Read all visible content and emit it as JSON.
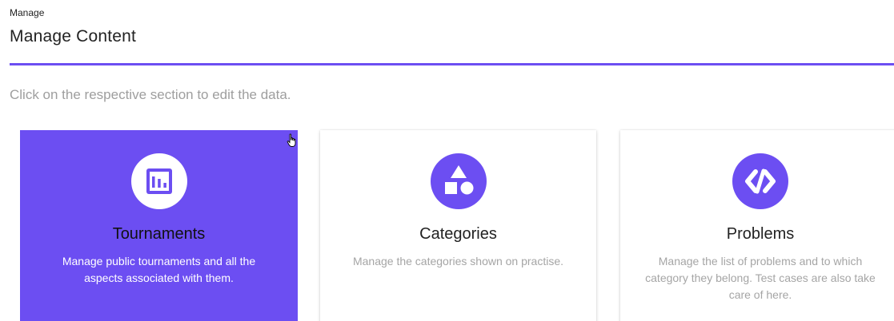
{
  "header": {
    "breadcrumb": "Manage",
    "title": "Manage Content"
  },
  "hint": "Click on the respective section to edit the data.",
  "cards": [
    {
      "title": "Tournaments",
      "description": "Manage public tournaments and all the aspects associated with them.",
      "icon": "bar-chart-icon",
      "active": true
    },
    {
      "title": "Categories",
      "description": "Manage the categories shown on practise.",
      "icon": "shapes-icon",
      "active": false
    },
    {
      "title": "Problems",
      "description": "Manage the list of problems and to which category they belong. Test cases are also take care of here.",
      "icon": "code-icon",
      "active": false
    }
  ],
  "colors": {
    "accent": "#6c4ef2",
    "hint_text": "#9e9e9e",
    "card_desc_text": "#a5a5a5"
  }
}
